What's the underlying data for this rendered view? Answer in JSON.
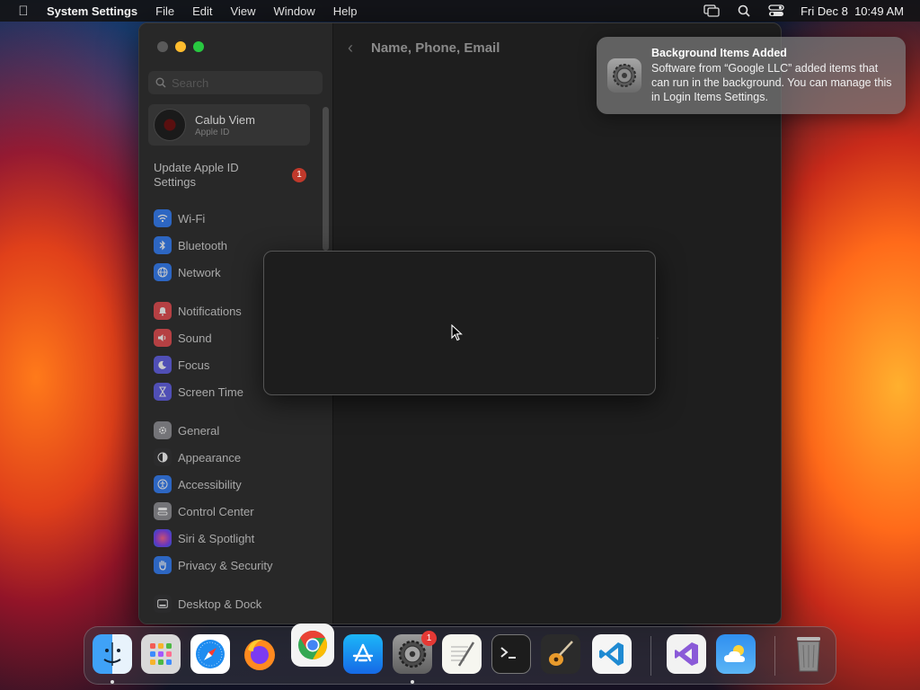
{
  "menubar": {
    "app_name": "System Settings",
    "menus": [
      "File",
      "Edit",
      "View",
      "Window",
      "Help"
    ],
    "clock": "Fri Dec 8  10:49 AM",
    "icons": [
      "screen-mirroring-icon",
      "spotlight-search-icon",
      "control-center-icon"
    ]
  },
  "window": {
    "header_title": "Name, Phone, Email",
    "ghost_text": "ngs.",
    "search": {
      "placeholder": "Search"
    },
    "account": {
      "name": "Calub Viem",
      "subtitle": "Apple ID"
    },
    "update": {
      "label": "Update Apple ID Settings",
      "badge": "1"
    },
    "sidebar": {
      "items": [
        {
          "label": "Wi-Fi",
          "icon": "wifi-icon",
          "color": "#2f7bf6"
        },
        {
          "label": "Bluetooth",
          "icon": "bluetooth-icon",
          "color": "#2f7bf6"
        },
        {
          "label": "Network",
          "icon": "globe-icon",
          "color": "#2f7bf6"
        },
        {
          "label": "Notifications",
          "icon": "bell-icon",
          "color": "#e5484d"
        },
        {
          "label": "Sound",
          "icon": "speaker-icon",
          "color": "#e5484d"
        },
        {
          "label": "Focus",
          "icon": "moon-icon",
          "color": "#5e5ce6"
        },
        {
          "label": "Screen Time",
          "icon": "hourglass-icon",
          "color": "#5e5ce6"
        },
        {
          "label": "General",
          "icon": "gear-icon",
          "color": "#8e8e93"
        },
        {
          "label": "Appearance",
          "icon": "appearance-icon",
          "color": "#2c2c2e"
        },
        {
          "label": "Accessibility",
          "icon": "accessibility-icon",
          "color": "#2f7bf6"
        },
        {
          "label": "Control Center",
          "icon": "control-center-icon",
          "color": "#8e8e93"
        },
        {
          "label": "Siri & Spotlight",
          "icon": "siri-icon",
          "color": "#bf5af2"
        },
        {
          "label": "Privacy & Security",
          "icon": "hand-icon",
          "color": "#2f7bf6"
        },
        {
          "label": "Desktop & Dock",
          "icon": "dock-icon",
          "color": "#2c2c2e"
        }
      ]
    }
  },
  "notification": {
    "title": "Background Items Added",
    "body": "Software from “Google LLC” added items that can run in the background. You can manage this in Login Items Settings."
  },
  "dock": {
    "apps": [
      {
        "name": "Finder",
        "icon": "finder-icon",
        "running": true
      },
      {
        "name": "Launchpad",
        "icon": "launchpad-icon",
        "running": false
      },
      {
        "name": "Safari",
        "icon": "safari-icon",
        "running": false
      },
      {
        "name": "Firefox",
        "icon": "firefox-icon",
        "running": false
      },
      {
        "name": "Google Chrome",
        "icon": "chrome-icon",
        "running": false
      },
      {
        "name": "App Store",
        "icon": "app-store-icon",
        "running": false
      },
      {
        "name": "System Settings",
        "icon": "settings-icon",
        "running": true,
        "badge": "1"
      },
      {
        "name": "TextEdit",
        "icon": "textedit-icon",
        "running": false
      },
      {
        "name": "Terminal",
        "icon": "terminal-icon",
        "running": false
      },
      {
        "name": "GarageBand",
        "icon": "guitar-icon",
        "running": false
      },
      {
        "name": "Visual Studio Code",
        "icon": "vscode-icon",
        "running": false
      },
      {
        "name": "Visual Studio",
        "icon": "visual-studio-icon",
        "running": false
      },
      {
        "name": "Weather",
        "icon": "weather-icon",
        "running": false
      },
      {
        "name": "Trash",
        "icon": "trash-icon",
        "running": false
      }
    ]
  }
}
